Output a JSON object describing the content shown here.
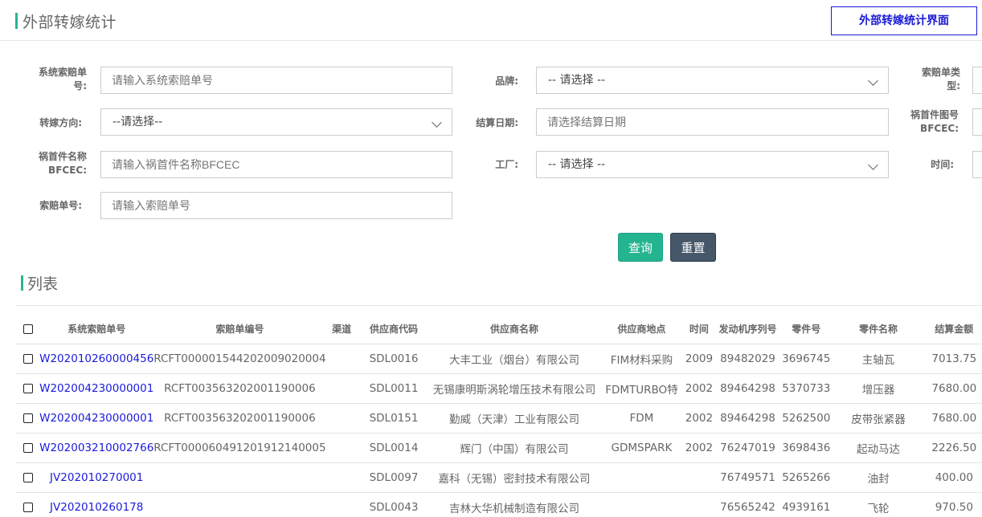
{
  "header": {
    "title": "外部转嫁统计",
    "annotation": "外部转嫁统计界面"
  },
  "form": {
    "claim_no_label": "系统索赔单号:",
    "claim_no_placeholder": "请输入系统索赔单号",
    "brand_label": "品牌:",
    "brand_value": "-- 请选择 --",
    "claim_type_label": "索赔单类型:",
    "direction_label": "转嫁方向:",
    "direction_value": "--请选择--",
    "settle_date_label": "结算日期:",
    "settle_date_placeholder": "请选择结算日期",
    "part_drawing_label": "祸首件图号BFCEC:",
    "part_name_label": "祸首件名称BFCEC:",
    "part_name_placeholder": "请输入祸首件名称BFCEC",
    "factory_label": "工厂:",
    "factory_value": "-- 请选择 --",
    "time_label": "时间:",
    "claim_order_label": "索赔单号:",
    "claim_order_placeholder": "请输入索赔单号",
    "query_button": "查询",
    "reset_button": "重置"
  },
  "list": {
    "title": "列表",
    "columns": [
      "系统索赔单号",
      "索赔单编号",
      "渠道",
      "供应商代码",
      "供应商名称",
      "供应商地点",
      "时间",
      "发动机序列号",
      "零件号",
      "零件名称",
      "结算金额"
    ],
    "rows": [
      [
        "W202010260000456",
        "RCFT000001544202009020004",
        "",
        "SDL0016",
        "大丰工业（烟台）有限公司",
        "FIM材料采购",
        "2009",
        "89482029",
        "3696745",
        "主轴瓦",
        "7013.75"
      ],
      [
        "W202004230000001",
        "RCFT003563202001190006",
        "",
        "SDL0011",
        "无锡康明斯涡轮增压技术有限公司",
        "FDMTURBO特",
        "2002",
        "89464298",
        "5370733",
        "增压器",
        "7680.00"
      ],
      [
        "W202004230000001",
        "RCFT003563202001190006",
        "",
        "SDL0151",
        "勤威（天津）工业有限公司",
        "FDM",
        "2002",
        "89464298",
        "5262500",
        "皮带张紧器",
        "7680.00"
      ],
      [
        "W202003210002766",
        "RCFT000060491201912140005",
        "",
        "SDL0014",
        "辉门（中国）有限公司",
        "GDMSPARK",
        "2002",
        "76247019",
        "3698436",
        "起动马达",
        "2226.50"
      ],
      [
        "JV202010270001",
        "",
        "",
        "SDL0097",
        "嘉科（无锡）密封技术有限公司",
        "",
        "",
        "76749571",
        "5265266",
        "油封",
        "400.00"
      ],
      [
        "JV202010260178",
        "",
        "",
        "SDL0043",
        "吉林大华机械制造有限公司",
        "",
        "",
        "76565242",
        "4939161",
        "飞轮",
        "970.50"
      ]
    ]
  }
}
